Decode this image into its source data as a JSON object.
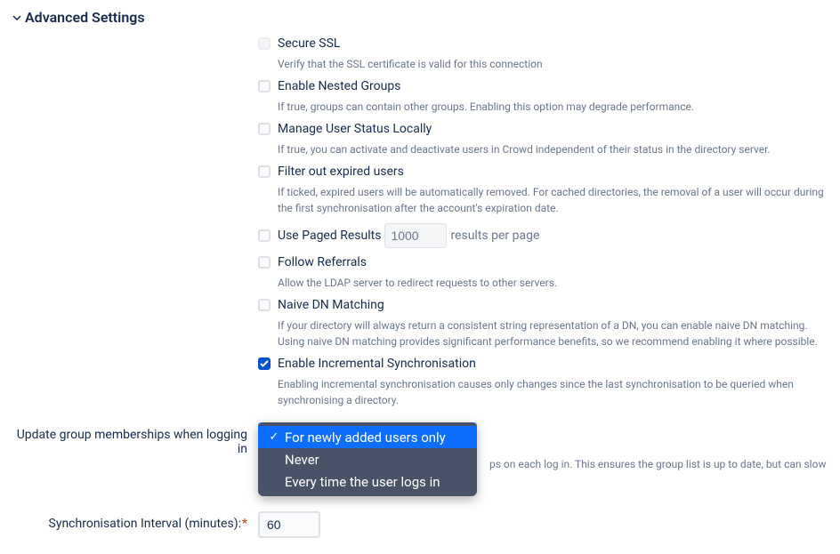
{
  "section": {
    "title": "Advanced Settings"
  },
  "options": {
    "secure_ssl": {
      "label": "Secure SSL",
      "desc": "Verify that the SSL certificate is valid for this connection"
    },
    "nested_groups": {
      "label": "Enable Nested Groups",
      "desc": "If true, groups can contain other groups. Enabling this option may degrade performance."
    },
    "manage_status": {
      "label": "Manage User Status Locally",
      "desc": "If true, you can activate and deactivate users in Crowd independent of their status in the directory server."
    },
    "filter_expired": {
      "label": "Filter out expired users",
      "desc": "If ticked, expired users will be automatically removed. For cached directories, the removal of a user will occur during the first synchronisation after the account's expiration date."
    },
    "paged_results": {
      "label": "Use Paged Results",
      "value": "1000",
      "suffix": "results per page"
    },
    "follow_referrals": {
      "label": "Follow Referrals",
      "desc": "Allow the LDAP server to redirect requests to other servers."
    },
    "naive_dn": {
      "label": "Naive DN Matching",
      "desc": "If your directory will always return a consistent string representation of a DN, you can enable naive DN matching. Using naive DN matching provides significant performance benefits, so we recommend enabling it where possible."
    },
    "incremental_sync": {
      "label": "Enable Incremental Synchronisation",
      "desc": "Enabling incremental synchronisation causes only changes since the last synchronisation to be queried when synchronising a directory."
    }
  },
  "update_memberships": {
    "label": "Update group memberships when logging in",
    "desc_fragment": "ps on each log in. This ensures the group list is up to date, but can slow",
    "dropdown": {
      "opt1": "For newly added users only",
      "opt2": "Never",
      "opt3": "Every time the user logs in"
    }
  },
  "sync_interval": {
    "label": "Synchronisation Interval (minutes):",
    "value": "60"
  }
}
